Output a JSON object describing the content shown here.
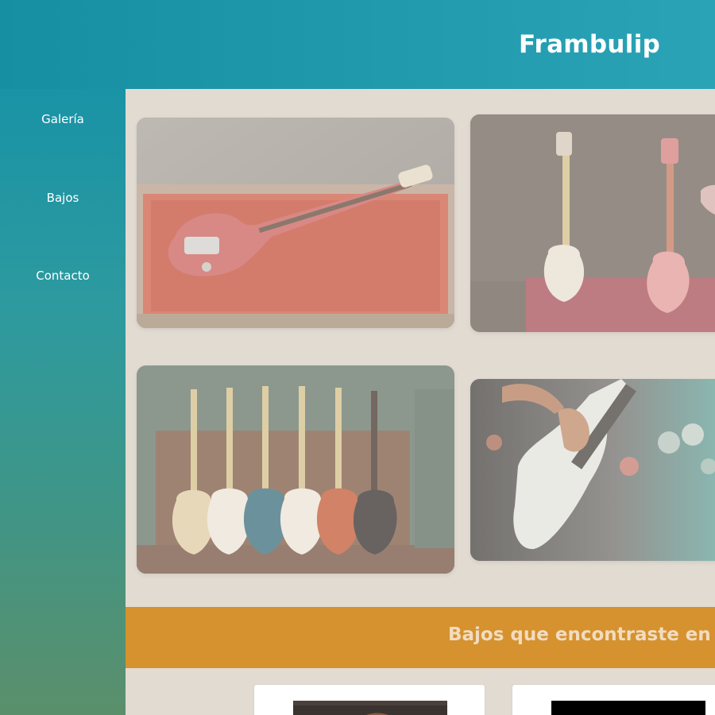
{
  "header": {
    "title": "Frambulip"
  },
  "sidebar": {
    "items": [
      {
        "label": "Galería"
      },
      {
        "label": "Bajos"
      },
      {
        "label": "Contacto"
      }
    ]
  },
  "gallery": {
    "photos": [
      {
        "subject": "red bass guitar in open case"
      },
      {
        "subject": "two bass guitars on stands"
      },
      {
        "subject": "row of six bass guitars"
      },
      {
        "subject": "hands playing a bass guitar"
      }
    ]
  },
  "banner": {
    "text": "Bajos que encontraste en es"
  },
  "colors": {
    "header_start": "#168fa2",
    "header_end": "#2aa3b6",
    "content_bg": "#e2dbd2",
    "banner_bg": "#d5922e",
    "banner_text": "#f2dcc0"
  }
}
